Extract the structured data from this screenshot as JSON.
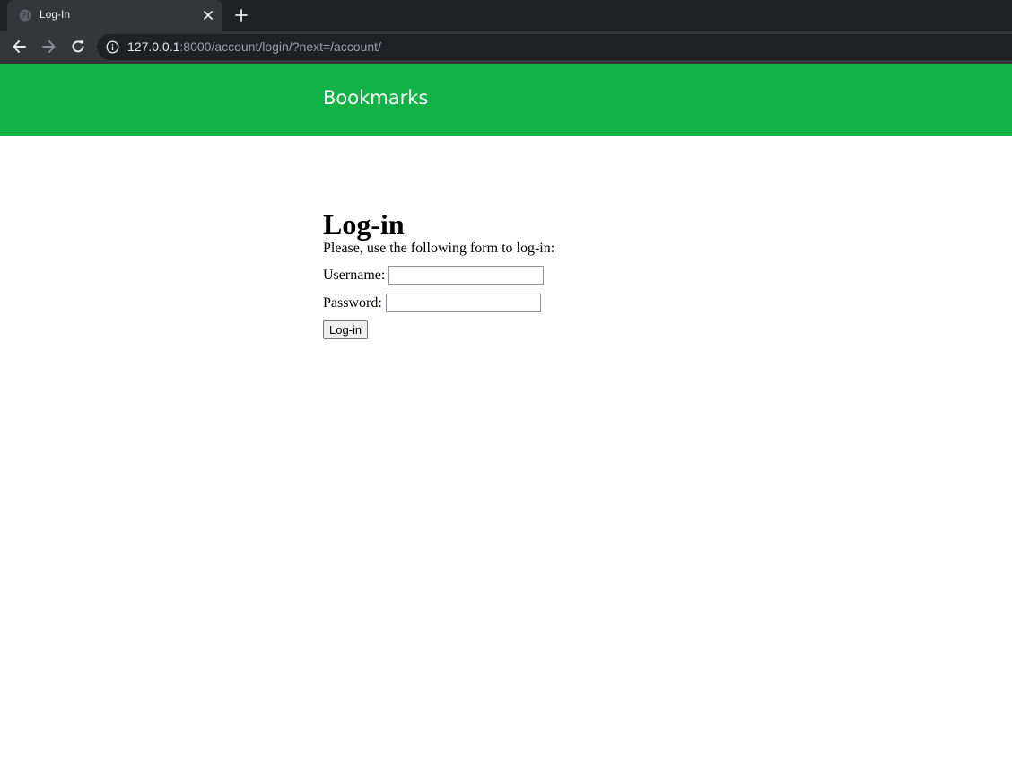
{
  "browser": {
    "tab_title": "Log-In",
    "url_host": "127.0.0.1",
    "url_rest": ":8000/account/login/?next=/account/"
  },
  "header": {
    "logo": "Bookmarks"
  },
  "main": {
    "title": "Log-in",
    "intro": "Please, use the following form to log-in:",
    "username_label": "Username:",
    "username_value": "",
    "password_label": "Password:",
    "password_value": "",
    "submit_label": "Log-in"
  },
  "colors": {
    "header_bg": "#12b346",
    "chrome_bg": "#202124"
  }
}
